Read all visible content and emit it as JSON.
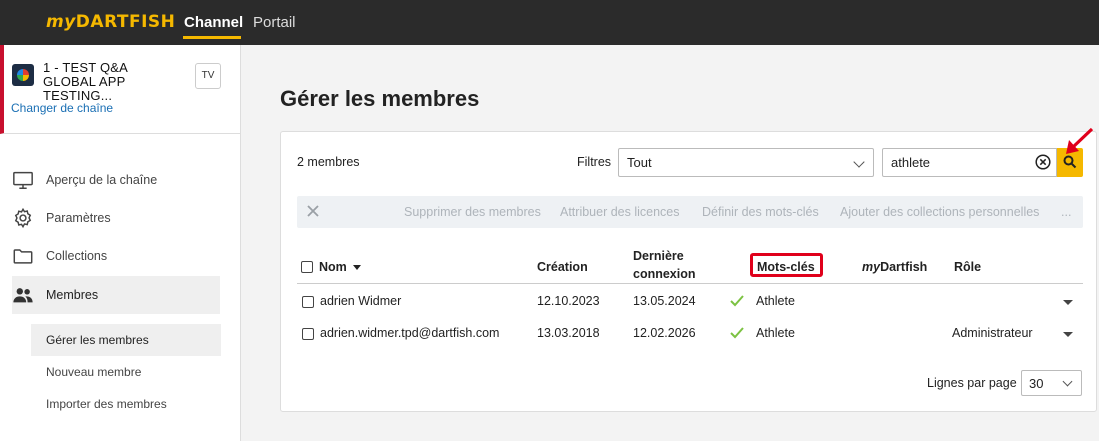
{
  "topbar": {
    "logo_my": "my",
    "logo_brand": "DARTFISH",
    "tabs": [
      {
        "label": "Channel",
        "active": true
      },
      {
        "label": "Portail",
        "active": false
      }
    ]
  },
  "sidebar": {
    "channel_title": "1 - TEST Q&A GLOBAL APP TESTING...",
    "tv_label": "TV",
    "change_channel": "Changer de chaîne",
    "items": [
      {
        "label": "Aperçu de la chaîne",
        "icon": "monitor-icon"
      },
      {
        "label": "Paramètres",
        "icon": "gear-icon"
      },
      {
        "label": "Collections",
        "icon": "folder-icon"
      },
      {
        "label": "Membres",
        "icon": "people-icon",
        "active": true
      }
    ],
    "sub_items": [
      {
        "label": "Gérer les membres",
        "active": true
      },
      {
        "label": "Nouveau membre"
      },
      {
        "label": "Importer des membres"
      }
    ]
  },
  "main": {
    "title": "Gérer les membres",
    "member_count": "2  membres",
    "filters_label": "Filtres",
    "filter_value": "Tout",
    "search_value": "athlete",
    "toolbar_actions": [
      "Supprimer des membres",
      "Attribuer des licences",
      "Définir des mots-clés",
      "Ajouter des collections personnelles",
      "..."
    ],
    "table": {
      "headers": {
        "name": "Nom",
        "creation": "Création",
        "last_login_1": "Dernière",
        "last_login_2": "connexion",
        "keywords": "Mots-clés",
        "mydartfish_my": "my",
        "mydartfish_rest": "Dartfish",
        "role": "Rôle"
      },
      "rows": [
        {
          "name": "adrien Widmer",
          "created": "12.10.2023",
          "last_login": "13.05.2024",
          "keyword": "Athlete",
          "role": ""
        },
        {
          "name": "adrien.widmer.tpd@dartfish.com",
          "created": "13.03.2018",
          "last_login": "12.02.2026",
          "keyword": "Athlete",
          "role": "Administrateur"
        }
      ]
    },
    "rows_per_page_label": "Lignes par page",
    "rows_per_page_value": "30"
  },
  "colors": {
    "accent": "#f5b800",
    "topbar": "#2b2b2b",
    "highlight": "#e0001b",
    "link": "#1a6fb4",
    "check": "#7cc242"
  }
}
